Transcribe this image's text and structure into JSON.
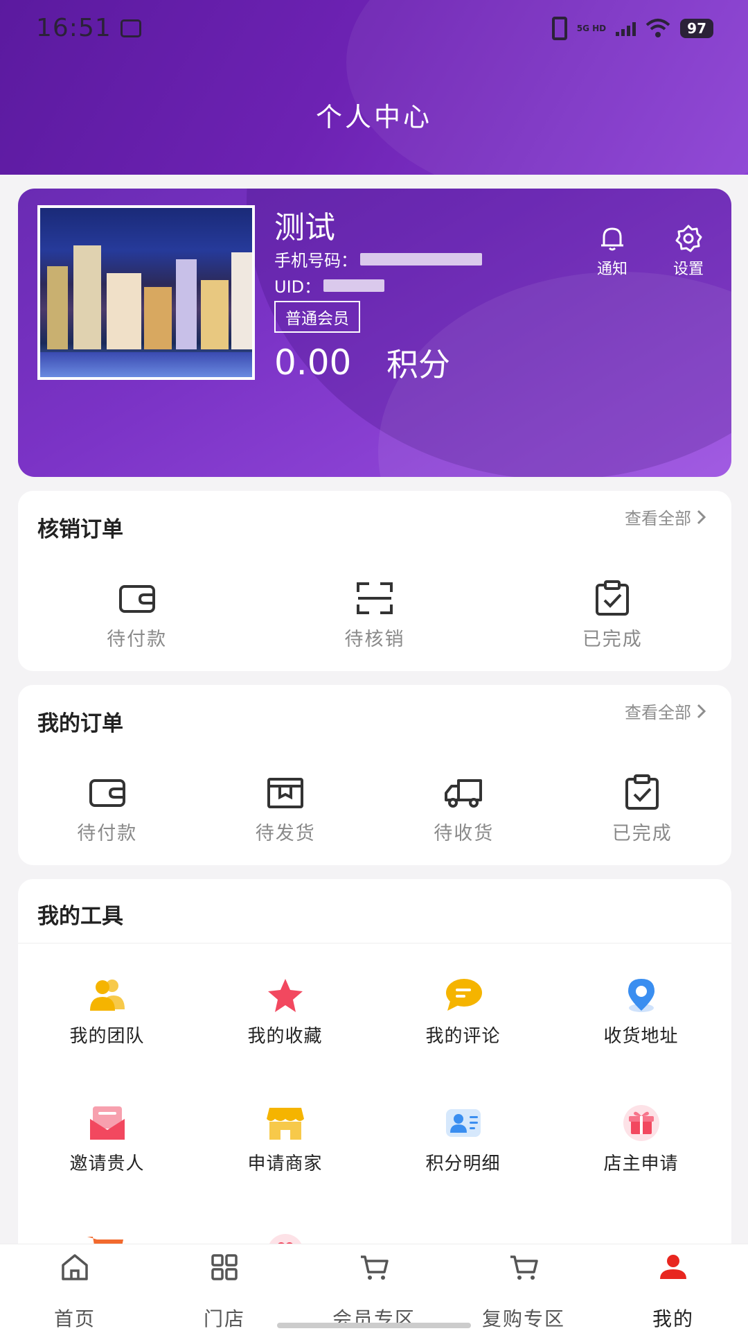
{
  "status_bar": {
    "time": "16:51",
    "network": "5G HD",
    "battery": "97"
  },
  "header": {
    "title": "个人中心"
  },
  "profile": {
    "name": "测试",
    "phone_label": "手机号码：",
    "uid_label": "UID：",
    "member_level": "普通会员",
    "points_value": "0.00",
    "points_label": "积分",
    "actions": [
      {
        "label": "通知",
        "icon": "bell-icon"
      },
      {
        "label": "设置",
        "icon": "gear-icon"
      }
    ]
  },
  "verify_orders": {
    "title": "核销订单",
    "see_all": "查看全部",
    "items": [
      {
        "label": "待付款",
        "icon": "wallet-icon"
      },
      {
        "label": "待核销",
        "icon": "scan-icon"
      },
      {
        "label": "已完成",
        "icon": "clipboard-check-icon"
      }
    ]
  },
  "my_orders": {
    "title": "我的订单",
    "see_all": "查看全部",
    "items": [
      {
        "label": "待付款",
        "icon": "wallet-icon"
      },
      {
        "label": "待发货",
        "icon": "box-icon"
      },
      {
        "label": "待收货",
        "icon": "truck-icon"
      },
      {
        "label": "已完成",
        "icon": "clipboard-check-icon"
      }
    ]
  },
  "tools": {
    "title": "我的工具",
    "items": [
      {
        "label": "我的团队",
        "icon": "team-icon",
        "color": "#f5b400"
      },
      {
        "label": "我的收藏",
        "icon": "star-icon",
        "color": "#f2485f"
      },
      {
        "label": "我的评论",
        "icon": "comment-icon",
        "color": "#f5b400"
      },
      {
        "label": "收货地址",
        "icon": "location-icon",
        "color": "#3a8ef0"
      },
      {
        "label": "邀请贵人",
        "icon": "envelope-icon",
        "color": "#f2485f"
      },
      {
        "label": "申请商家",
        "icon": "store-icon",
        "color": "#f5b400"
      },
      {
        "label": "积分明细",
        "icon": "id-card-icon",
        "color": "#3a8ef0"
      },
      {
        "label": "店主申请",
        "icon": "gift-icon",
        "color": "#f2485f"
      }
    ]
  },
  "bottom_nav": {
    "items": [
      {
        "label": "首页",
        "icon": "home-icon"
      },
      {
        "label": "门店",
        "icon": "grid-icon"
      },
      {
        "label": "会员专区",
        "icon": "cart-icon"
      },
      {
        "label": "复购专区",
        "icon": "cart-icon"
      },
      {
        "label": "我的",
        "icon": "user-icon"
      }
    ],
    "active_color": "#e8261f"
  },
  "colors": {
    "brand_purple": "#6d22b3",
    "accent_red": "#e8261f"
  }
}
